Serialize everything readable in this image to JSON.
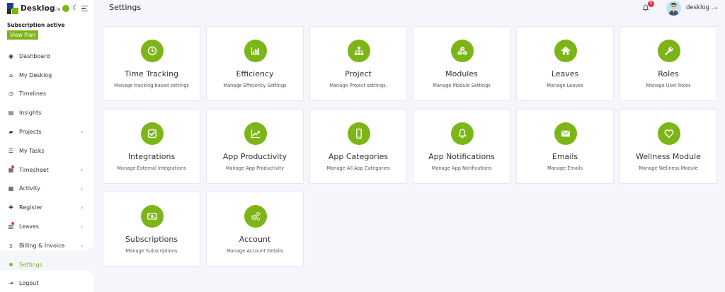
{
  "logo": {
    "name": "Desklog",
    "suffix": ".io"
  },
  "subscription": {
    "status": "Subscription active",
    "button": "View Plan"
  },
  "nav": [
    {
      "label": "Dashboard",
      "icon": "dashboard-icon",
      "glyph": "◉",
      "chevron": false,
      "dot": false,
      "active": false
    },
    {
      "label": "My Desklog",
      "icon": "home-icon",
      "glyph": "⌂",
      "chevron": false,
      "dot": false,
      "active": false
    },
    {
      "label": "Timelines",
      "icon": "clock-icon",
      "glyph": "◷",
      "chevron": false,
      "dot": false,
      "active": false
    },
    {
      "label": "Insights",
      "icon": "book-icon",
      "glyph": "▤",
      "chevron": false,
      "dot": false,
      "active": false
    },
    {
      "label": "Projects",
      "icon": "folder-icon",
      "glyph": "▰",
      "chevron": true,
      "dot": false,
      "active": false
    },
    {
      "label": "My Tasks",
      "icon": "tasks-icon",
      "glyph": "☰",
      "chevron": false,
      "dot": false,
      "active": false
    },
    {
      "label": "Timesheet",
      "icon": "timesheet-icon",
      "glyph": "▦",
      "chevron": true,
      "dot": true,
      "active": false
    },
    {
      "label": "Activity",
      "icon": "grid-icon",
      "glyph": "▦",
      "chevron": true,
      "dot": false,
      "active": false
    },
    {
      "label": "Register",
      "icon": "plus-icon",
      "glyph": "✚",
      "chevron": true,
      "dot": false,
      "active": false
    },
    {
      "label": "Leaves",
      "icon": "leaves-icon",
      "glyph": "▥",
      "chevron": true,
      "dot": true,
      "active": false
    },
    {
      "label": "Billing & Invoice",
      "icon": "invoice-icon",
      "glyph": "▯",
      "chevron": true,
      "dot": false,
      "active": false
    },
    {
      "label": "Settings",
      "icon": "gear-icon",
      "glyph": "✹",
      "chevron": false,
      "dot": false,
      "active": true
    },
    {
      "label": "Logout",
      "icon": "logout-icon",
      "glyph": "⇥",
      "chevron": false,
      "dot": false,
      "active": false
    }
  ],
  "header": {
    "title": "Settings",
    "notifications": "5",
    "user": "desklog ..."
  },
  "cards": [
    {
      "title": "Time Tracking",
      "desc": "Manage tracking based settings",
      "icon": "clock-icon"
    },
    {
      "title": "Efficiency",
      "desc": "Manage Efficiency Settings",
      "icon": "bar-chart-icon"
    },
    {
      "title": "Project",
      "desc": "Manage Project settings.",
      "icon": "sitemap-icon"
    },
    {
      "title": "Modules",
      "desc": "Manage Module Settings",
      "icon": "cubes-icon"
    },
    {
      "title": "Leaves",
      "desc": "Manage Leaves",
      "icon": "home-icon"
    },
    {
      "title": "Roles",
      "desc": "Manage User Roles",
      "icon": "wrench-icon"
    },
    {
      "title": "Integrations",
      "desc": "Manage External Integrations",
      "icon": "check-square-icon"
    },
    {
      "title": "App Productivity",
      "desc": "Manage App Productivity",
      "icon": "line-chart-icon"
    },
    {
      "title": "App Categories",
      "desc": "Manage All App Categories",
      "icon": "mobile-icon"
    },
    {
      "title": "App Notifications",
      "desc": "Manage App Notifications",
      "icon": "bell-icon"
    },
    {
      "title": "Emails",
      "desc": "Manage Emails",
      "icon": "envelope-icon"
    },
    {
      "title": "Wellness Module",
      "desc": "Manage Wellness Module",
      "icon": "heart-icon"
    },
    {
      "title": "Subscriptions",
      "desc": "Manage Subscriptions",
      "icon": "money-bill-icon"
    },
    {
      "title": "Account",
      "desc": "Manage Account Details",
      "icon": "gears-icon"
    }
  ],
  "colors": {
    "accent": "#7cb518",
    "badge": "#e53935",
    "background": "#f4f6fb"
  }
}
